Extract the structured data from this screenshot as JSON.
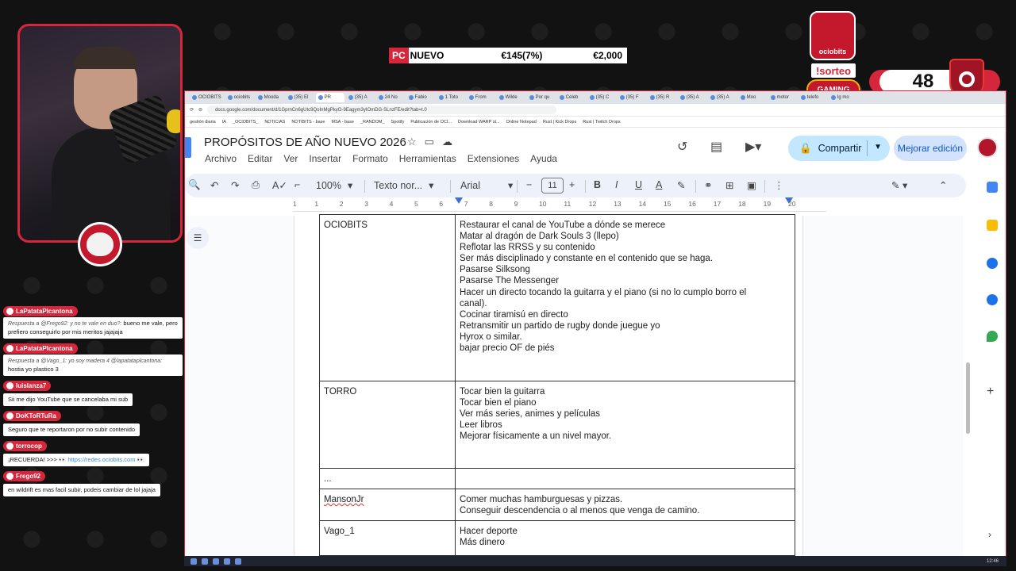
{
  "overlay": {
    "ticker": {
      "tag": "PC",
      "tag2": "NUEVO",
      "mid": "€145(7%)",
      "right": "€2,000"
    },
    "sponsor_label": "ociobits",
    "sorteo": "!sorteo",
    "gaming_badge": "GAMING",
    "counter": "48"
  },
  "chat": [
    {
      "user": "LaPatataPlcantona",
      "reply": "Respuesta a @Frego92: y no te vale en duo?:",
      "text": "bueno me vale, pero prefiero conseguirlo por mis meritos jajajaja"
    },
    {
      "user": "LaPatataPlcantona",
      "reply": "Respuesta a @Vago_1: yo soy madera 4 @lapatataplcantona:",
      "text": "hostia yo plastico 3"
    },
    {
      "user": "luislanza7",
      "reply": "",
      "text": "Sii me dijo YouTube que se cancelaba mi sub"
    },
    {
      "user": "DoKToRTuRa",
      "reply": "",
      "text": "Seguro que te reportaron por no subir contenido"
    },
    {
      "user": "torrocop",
      "reply": "",
      "text": "¡RECUERDA! >>> 👀",
      "link": "https://redes.ociobits.com 👀"
    },
    {
      "user": "Frego92",
      "reply": "",
      "text": "en wildrift es mas facil subir, podeis cambiar de lol jajaja"
    }
  ],
  "browser": {
    "tabs": [
      "OCIOBITS",
      "ociobits",
      "Mooda",
      "(35) El",
      "PR",
      "(35) A",
      "24 No",
      "Fabio",
      "1 Toto",
      "From",
      "Wilde",
      "Por qu",
      "Celeb",
      "(35) C",
      "(35) F",
      "(35) R",
      "(35) A",
      "(35) A",
      "Moo",
      "motor",
      "telefo",
      "Ig mo"
    ],
    "active_tab_index": 4,
    "url": "docs.google.com/document/d/1GprnCn6gUtc9QoInMgPkyO-9Eagym3yIOmDG-SLnzFE/edit?tab=t.0",
    "bookmarks": [
      "gestión diaria",
      "IA",
      "_OCIOBITS_",
      "NOTICIAS",
      "NOTIBITS - base",
      "MSA - base",
      "_RANDOM_",
      "Spotify",
      "Publicación de OCI...",
      "Download WARP st...",
      "Online Notepad",
      "Rust | Kick Drops",
      "Rust | Twitch Drops"
    ]
  },
  "docs": {
    "title": "PROPÓSITOS DE AÑO NUEVO 2026",
    "menu": [
      "Archivo",
      "Editar",
      "Ver",
      "Insertar",
      "Formato",
      "Herramientas",
      "Extensiones",
      "Ayuda"
    ],
    "share_label": "Compartir",
    "mejorar_label": "Mejorar edición",
    "toolbar": {
      "zoom": "100%",
      "style": "Texto nor...",
      "font": "Arial",
      "font_size": "11"
    },
    "ruler": [
      "1",
      "1",
      "2",
      "3",
      "4",
      "5",
      "6",
      "7",
      "8",
      "9",
      "10",
      "11",
      "12",
      "13",
      "14",
      "15",
      "16",
      "17",
      "18",
      "19",
      "20"
    ]
  },
  "table": [
    {
      "name": "OCIOBITS",
      "goals": [
        "Restaurar el canal de YouTube a dónde se merece",
        "Matar al dragón de Dark Souls 3 (llepo)",
        "Reflotar las RRSS y su contenido",
        "Ser más disciplinado y constante en el contenido que se haga.",
        "Pasarse Silksong",
        "Pasarse The Messenger",
        "Hacer un directo tocando la guitarra y el piano (si no lo cumplo borro el",
        "canal).",
        "Cocinar tiramisú en directo",
        "Retransmitir un partido de rugby donde juegue yo",
        "Hyrox o similar.",
        "bajar precio OF de piés"
      ]
    },
    {
      "name": "TORRO",
      "goals": [
        "Tocar bien la guitarra",
        "Tocar bien el piano",
        "Ver más series, animes y películas",
        "Leer libros",
        "Mejorar físicamente a un nivel mayor."
      ]
    },
    {
      "name": "...",
      "goals": []
    },
    {
      "name": "MansonJr",
      "goals": [
        "Comer muchas hamburguesas y pizzas.",
        "Conseguir descendencia o al menos que venga de camino."
      ]
    },
    {
      "name": "Vago_1",
      "goals": [
        "Hacer deporte",
        "Más dinero"
      ]
    }
  ],
  "taskbar_time": "12:46"
}
